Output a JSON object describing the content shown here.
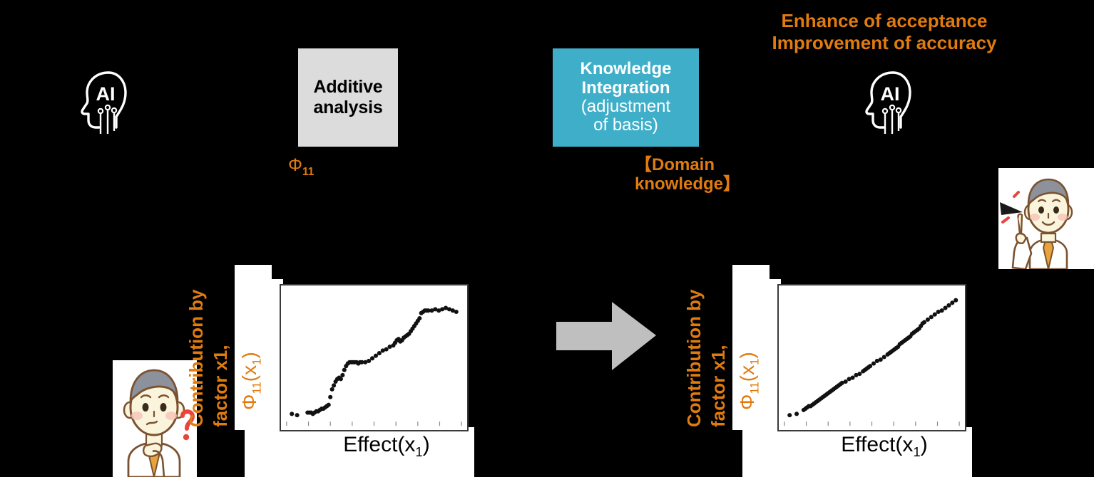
{
  "palette": {
    "background": "#000000",
    "orange": "#E07B10",
    "teal": "#3FAFC9",
    "gray_box": "#DCDCDC",
    "arrow_gray": "#BFBFBF",
    "white": "#FFFFFF",
    "point_black": "#111111",
    "red_accent": "#E8453C"
  },
  "header": {
    "benefit_line1": "Enhance of acceptance",
    "benefit_line2": "Improvement of accuracy"
  },
  "icons": {
    "ai_left": "ai-head-icon",
    "ai_right": "ai-head-icon",
    "arrow": "right-arrow-icon",
    "person_confused": "confused-person-icon",
    "person_insight": "insight-person-icon"
  },
  "additive_box": {
    "line1": "Additive",
    "line2": "analysis",
    "caption_symbol": "Φ",
    "caption_sub": "11"
  },
  "knowledge_box": {
    "line1": "Knowledge",
    "line2": "Integration",
    "line3": "(adjustment",
    "line4": "of  basis)",
    "caption_line1": "【Domain",
    "caption_line2": "knowledge】"
  },
  "chart_data": [
    {
      "id": "before",
      "type": "scatter",
      "title": "",
      "ylabel_line1": "Contribution by",
      "ylabel_line2": "factor x1,",
      "ylabel_symbol": "Φ",
      "ylabel_sub": "11",
      "ylabel_arg": "(x",
      "ylabel_arg_sub": "1",
      "ylabel_arg_close": ")",
      "xlabel": "Effect(x",
      "xlabel_sub": "1",
      "xlabel_close": ")",
      "xlim": [
        0,
        100
      ],
      "ylim": [
        0,
        100
      ],
      "grid": false,
      "legend": "none",
      "x": [
        3,
        6,
        12,
        13,
        14,
        15,
        16,
        17,
        18,
        19,
        20,
        21,
        22,
        23,
        24,
        25,
        26,
        27,
        28,
        29,
        30,
        31,
        32,
        33,
        34,
        35,
        36,
        37,
        38,
        39,
        40,
        41,
        42,
        43,
        45,
        47,
        49,
        51,
        53,
        55,
        57,
        59,
        61,
        62,
        63,
        64,
        65,
        66,
        67,
        68,
        69,
        70,
        71,
        72,
        73,
        74,
        75,
        76,
        77,
        78,
        79,
        80,
        81,
        83,
        85,
        87,
        89,
        91,
        93,
        95,
        97
      ],
      "y": [
        6,
        5,
        7,
        7,
        7,
        6,
        7,
        8,
        8,
        9,
        10,
        10,
        11,
        12,
        13,
        19,
        25,
        28,
        31,
        33,
        34,
        33,
        36,
        40,
        43,
        45,
        46,
        46,
        46,
        46,
        46,
        45,
        46,
        46,
        46,
        47,
        49,
        51,
        53,
        55,
        56,
        58,
        59,
        61,
        63,
        64,
        62,
        63,
        65,
        66,
        67,
        68,
        70,
        72,
        74,
        76,
        78,
        80,
        84,
        85,
        86,
        86,
        86,
        86,
        87,
        86,
        87,
        88,
        87,
        86,
        85
      ]
    },
    {
      "id": "after",
      "type": "scatter",
      "title": "",
      "ylabel_line1": "Contribution by",
      "ylabel_line2": "factor x1,",
      "ylabel_symbol": "Φ",
      "ylabel_sub": "11",
      "ylabel_arg": "(x",
      "ylabel_arg_sub": "1",
      "ylabel_arg_close": ")",
      "xlabel": "Effect(x",
      "xlabel_sub": "1",
      "xlabel_close": ")",
      "xlim": [
        0,
        100
      ],
      "ylim": [
        0,
        100
      ],
      "grid": false,
      "legend": "none",
      "x": [
        3,
        7,
        11,
        12,
        13,
        14,
        15,
        16,
        17,
        18,
        19,
        20,
        21,
        22,
        23,
        24,
        25,
        26,
        27,
        28,
        29,
        30,
        31,
        32,
        33,
        35,
        37,
        39,
        41,
        43,
        45,
        46,
        47,
        48,
        49,
        51,
        53,
        55,
        57,
        59,
        60,
        61,
        62,
        63,
        64,
        65,
        66,
        67,
        68,
        69,
        70,
        71,
        72,
        73,
        74,
        75,
        76,
        77,
        78,
        79,
        80,
        82,
        84,
        86,
        88,
        90,
        92,
        94,
        96,
        98
      ],
      "y": [
        5,
        6,
        9,
        10,
        11,
        12,
        12,
        13,
        14,
        15,
        16,
        17,
        18,
        19,
        20,
        21,
        22,
        23,
        24,
        25,
        26,
        27,
        28,
        29,
        30,
        31,
        33,
        34,
        36,
        37,
        39,
        40,
        41,
        42,
        43,
        45,
        47,
        48,
        50,
        52,
        53,
        54,
        55,
        56,
        57,
        58,
        60,
        61,
        62,
        63,
        64,
        65,
        66,
        68,
        69,
        70,
        71,
        72,
        74,
        76,
        77,
        79,
        81,
        83,
        85,
        86,
        88,
        90,
        92,
        94
      ]
    }
  ]
}
